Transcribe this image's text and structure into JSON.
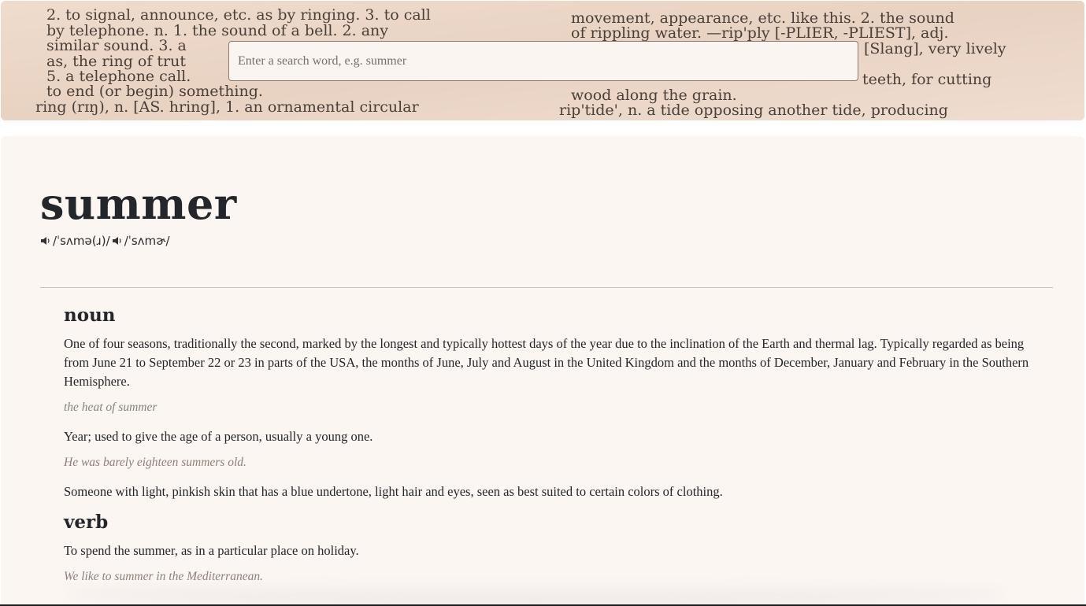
{
  "search": {
    "placeholder": "Enter a search word, e.g. summer",
    "value": ""
  },
  "banner": {
    "left_lines": [
      "2. to signal, announce, etc. as by ringing. 3. to call",
      "by telephone. n. 1. the sound of a bell. 2. any",
      "similar sound. 3. a",
      "as, the ring of trut",
      "5. a telephone call.",
      "to end (or begin) something.",
      "ring (rɪŋ), n. [AS. hring], 1. an ornamental circular"
    ],
    "right_lines": [
      "movement, appearance, etc. like this. 2. the sound",
      "of rippling water. —rip'ply [-PLIER, -PLIEST], adj.",
      "[Slang], very lively",
      "teeth, for cutting",
      "wood along the grain.",
      "rip'tide', n. a tide opposing another tide, producing"
    ]
  },
  "entry": {
    "word": "summer",
    "phonetics": [
      "/ˈsʌmə(ɹ)/",
      "/ˈsʌmɚ/"
    ],
    "meanings": [
      {
        "part_of_speech": "noun",
        "definitions": [
          {
            "definition": "One of four seasons, traditionally the second, marked by the longest and typically hottest days of the year due to the inclination of the Earth and thermal lag. Typically regarded as being from June 21 to September 22 or 23 in parts of the USA, the months of June, July and August in the United Kingdom and the months of December, January and February in the Southern Hemisphere.",
            "example": "the heat of summer"
          },
          {
            "definition": "Year; used to give the age of a person, usually a young one.",
            "example": "He was barely eighteen summers old."
          },
          {
            "definition": "Someone with light, pinkish skin that has a blue undertone, light hair and eyes, seen as best suited to certain colors of clothing.",
            "example": ""
          }
        ]
      },
      {
        "part_of_speech": "verb",
        "definitions": [
          {
            "definition": "To spend the summer, as in a particular place on holiday.",
            "example": "We like to summer in the Mediterranean."
          }
        ]
      }
    ]
  },
  "icons": {
    "speaker": "speaker-icon"
  },
  "colors": {
    "background": "#fcf6f3",
    "title": "#23262b",
    "example": "#8d8077",
    "banner": "#ead6c6"
  }
}
